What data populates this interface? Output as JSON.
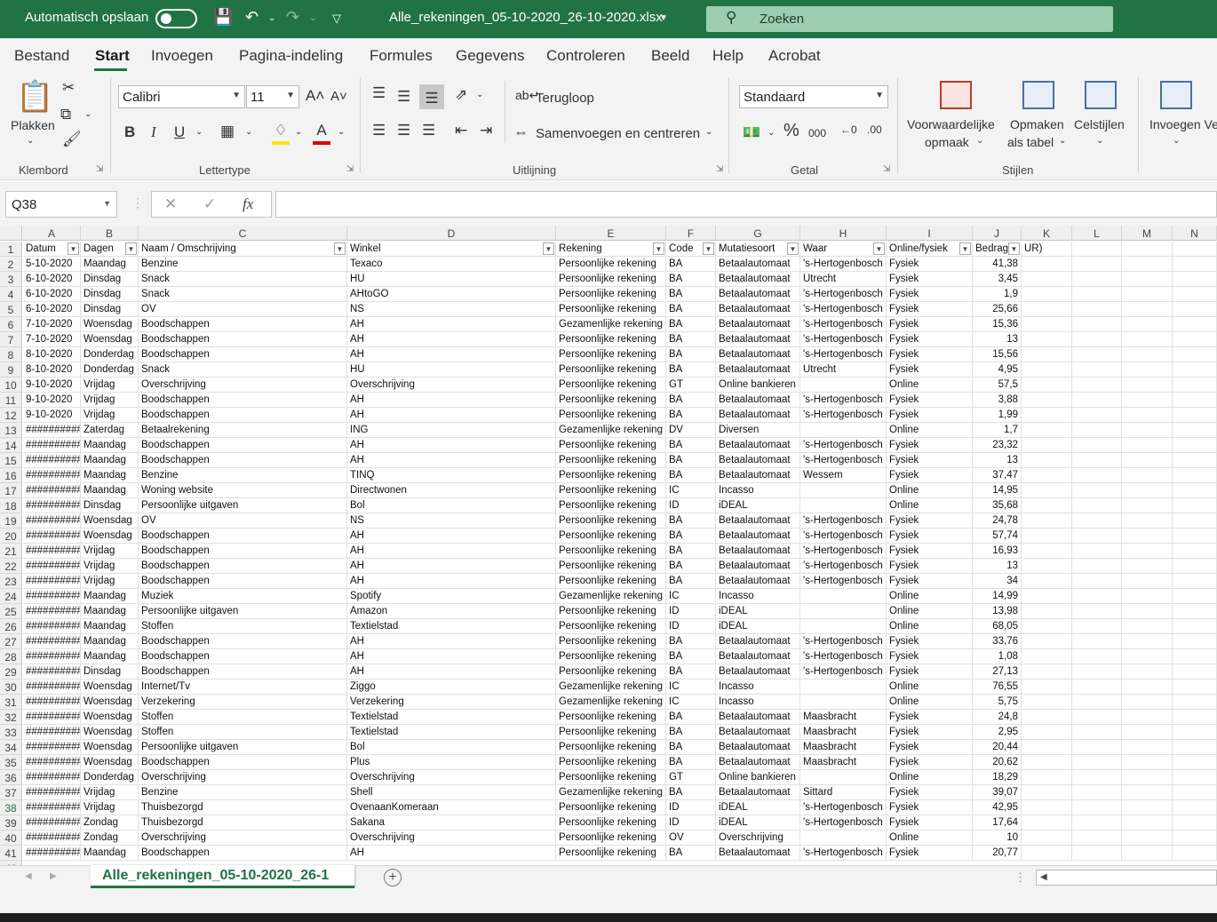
{
  "titlebar": {
    "autosave_label": "Automatisch opslaan",
    "filename": "Alle_rekeningen_05-10-2020_26-10-2020.xlsx",
    "search_placeholder": "Zoeken"
  },
  "menu": {
    "tabs": [
      "Bestand",
      "Start",
      "Invoegen",
      "Pagina-indeling",
      "Formules",
      "Gegevens",
      "Controleren",
      "Beeld",
      "Help",
      "Acrobat"
    ],
    "active": "Start"
  },
  "ribbon": {
    "clipboard": {
      "paste": "Plakken",
      "label": "Klembord"
    },
    "font": {
      "name": "Calibri",
      "size": "11",
      "label": "Lettertype"
    },
    "alignment": {
      "wrap": "Terugloop",
      "merge": "Samenvoegen en centreren",
      "label": "Uitlijning"
    },
    "number": {
      "format": "Standaard",
      "label": "Getal"
    },
    "styles": {
      "conditional_1": "Voorwaardelijke",
      "conditional_2": "opmaak",
      "table_1": "Opmaken",
      "table_2": "als tabel",
      "cellstyles": "Celstijlen",
      "label": "Stijlen"
    },
    "cells": {
      "insert": "Invoegen",
      "insert_tail": "Ve"
    }
  },
  "formula": {
    "namebox": "Q38",
    "fx": "fx",
    "content": ""
  },
  "columns": [
    "A",
    "B",
    "C",
    "D",
    "E",
    "F",
    "G",
    "H",
    "I",
    "J",
    "K",
    "L",
    "M",
    "N"
  ],
  "headers": [
    "Datum",
    "Dagen",
    "Naam / Omschrijving",
    "Winkel",
    "Rekening",
    "Code",
    "Mutatiesoort",
    "Waar",
    "Online/fysiek",
    "Bedrag",
    "UR)"
  ],
  "rows": [
    [
      "5-10-2020",
      "Maandag",
      "Benzine",
      "Texaco",
      "Persoonlijke rekening",
      "BA",
      "Betaalautomaat",
      "'s-Hertogenbosch",
      "Fysiek",
      "41,38"
    ],
    [
      "6-10-2020",
      "Dinsdag",
      "Snack",
      "HU",
      "Persoonlijke rekening",
      "BA",
      "Betaalautomaat",
      "Utrecht",
      "Fysiek",
      "3,45"
    ],
    [
      "6-10-2020",
      "Dinsdag",
      "Snack",
      "AHtoGO",
      "Persoonlijke rekening",
      "BA",
      "Betaalautomaat",
      "'s-Hertogenbosch",
      "Fysiek",
      "1,9"
    ],
    [
      "6-10-2020",
      "Dinsdag",
      "OV",
      "NS",
      "Persoonlijke rekening",
      "BA",
      "Betaalautomaat",
      "'s-Hertogenbosch",
      "Fysiek",
      "25,66"
    ],
    [
      "7-10-2020",
      "Woensdag",
      "Boodschappen",
      "AH",
      "Gezamenlijke rekening",
      "BA",
      "Betaalautomaat",
      "'s-Hertogenbosch",
      "Fysiek",
      "15,36"
    ],
    [
      "7-10-2020",
      "Woensdag",
      "Boodschappen",
      "AH",
      "Persoonlijke rekening",
      "BA",
      "Betaalautomaat",
      "'s-Hertogenbosch",
      "Fysiek",
      "13"
    ],
    [
      "8-10-2020",
      "Donderdag",
      "Boodschappen",
      "AH",
      "Persoonlijke rekening",
      "BA",
      "Betaalautomaat",
      "'s-Hertogenbosch",
      "Fysiek",
      "15,56"
    ],
    [
      "8-10-2020",
      "Donderdag",
      "Snack",
      "HU",
      "Persoonlijke rekening",
      "BA",
      "Betaalautomaat",
      "Utrecht",
      "Fysiek",
      "4,95"
    ],
    [
      "9-10-2020",
      "Vrijdag",
      "Overschrijving",
      "Overschrijving",
      "Persoonlijke rekening",
      "GT",
      "Online bankieren",
      "",
      "Online",
      "57,5"
    ],
    [
      "9-10-2020",
      "Vrijdag",
      "Boodschappen",
      "AH",
      "Persoonlijke rekening",
      "BA",
      "Betaalautomaat",
      "'s-Hertogenbosch",
      "Fysiek",
      "3,88"
    ],
    [
      "9-10-2020",
      "Vrijdag",
      "Boodschappen",
      "AH",
      "Persoonlijke rekening",
      "BA",
      "Betaalautomaat",
      "'s-Hertogenbosch",
      "Fysiek",
      "1,99"
    ],
    [
      "###########",
      "Zaterdag",
      "Betaalrekening",
      "ING",
      "Gezamenlijke rekening",
      "DV",
      "Diversen",
      "",
      "Online",
      "1,7"
    ],
    [
      "###########",
      "Maandag",
      "Boodschappen",
      "AH",
      "Persoonlijke rekening",
      "BA",
      "Betaalautomaat",
      "'s-Hertogenbosch",
      "Fysiek",
      "23,32"
    ],
    [
      "###########",
      "Maandag",
      "Boodschappen",
      "AH",
      "Persoonlijke rekening",
      "BA",
      "Betaalautomaat",
      "'s-Hertogenbosch",
      "Fysiek",
      "13"
    ],
    [
      "###########",
      "Maandag",
      "Benzine",
      "TINQ",
      "Persoonlijke rekening",
      "BA",
      "Betaalautomaat",
      "Wessem",
      "Fysiek",
      "37,47"
    ],
    [
      "###########",
      "Maandag",
      "Woning website",
      "Directwonen",
      "Persoonlijke rekening",
      "IC",
      "Incasso",
      "",
      "Online",
      "14,95"
    ],
    [
      "###########",
      "Dinsdag",
      "Persoonlijke uitgaven",
      "Bol",
      "Persoonlijke rekening",
      "ID",
      "iDEAL",
      "",
      "Online",
      "35,68"
    ],
    [
      "###########",
      "Woensdag",
      "OV",
      "NS",
      "Persoonlijke rekening",
      "BA",
      "Betaalautomaat",
      "'s-Hertogenbosch",
      "Fysiek",
      "24,78"
    ],
    [
      "###########",
      "Woensdag",
      "Boodschappen",
      "AH",
      "Persoonlijke rekening",
      "BA",
      "Betaalautomaat",
      "'s-Hertogenbosch",
      "Fysiek",
      "57,74"
    ],
    [
      "###########",
      "Vrijdag",
      "Boodschappen",
      "AH",
      "Persoonlijke rekening",
      "BA",
      "Betaalautomaat",
      "'s-Hertogenbosch",
      "Fysiek",
      "16,93"
    ],
    [
      "###########",
      "Vrijdag",
      "Boodschappen",
      "AH",
      "Persoonlijke rekening",
      "BA",
      "Betaalautomaat",
      "'s-Hertogenbosch",
      "Fysiek",
      "13"
    ],
    [
      "###########",
      "Vrijdag",
      "Boodschappen",
      "AH",
      "Persoonlijke rekening",
      "BA",
      "Betaalautomaat",
      "'s-Hertogenbosch",
      "Fysiek",
      "34"
    ],
    [
      "###########",
      "Maandag",
      "Muziek",
      "Spotify",
      "Gezamenlijke rekening",
      "IC",
      "Incasso",
      "",
      "Online",
      "14,99"
    ],
    [
      "###########",
      "Maandag",
      "Persoonlijke uitgaven",
      "Amazon",
      "Persoonlijke rekening",
      "ID",
      "iDEAL",
      "",
      "Online",
      "13,98"
    ],
    [
      "###########",
      "Maandag",
      "Stoffen",
      "Textielstad",
      "Persoonlijke rekening",
      "ID",
      "iDEAL",
      "",
      "Online",
      "68,05"
    ],
    [
      "###########",
      "Maandag",
      "Boodschappen",
      "AH",
      "Persoonlijke rekening",
      "BA",
      "Betaalautomaat",
      "'s-Hertogenbosch",
      "Fysiek",
      "33,76"
    ],
    [
      "###########",
      "Maandag",
      "Boodschappen",
      "AH",
      "Persoonlijke rekening",
      "BA",
      "Betaalautomaat",
      "'s-Hertogenbosch",
      "Fysiek",
      "1,08"
    ],
    [
      "###########",
      "Dinsdag",
      "Boodschappen",
      "AH",
      "Persoonlijke rekening",
      "BA",
      "Betaalautomaat",
      "'s-Hertogenbosch",
      "Fysiek",
      "27,13"
    ],
    [
      "###########",
      "Woensdag",
      "Internet/Tv",
      "Ziggo",
      "Gezamenlijke rekening",
      "IC",
      "Incasso",
      "",
      "Online",
      "76,55"
    ],
    [
      "###########",
      "Woensdag",
      "Verzekering",
      "Verzekering",
      "Gezamenlijke rekening",
      "IC",
      "Incasso",
      "",
      "Online",
      "5,75"
    ],
    [
      "###########",
      "Woensdag",
      "Stoffen",
      "Textielstad",
      "Persoonlijke rekening",
      "BA",
      "Betaalautomaat",
      "Maasbracht",
      "Fysiek",
      "24,8"
    ],
    [
      "###########",
      "Woensdag",
      "Stoffen",
      "Textielstad",
      "Persoonlijke rekening",
      "BA",
      "Betaalautomaat",
      "Maasbracht",
      "Fysiek",
      "2,95"
    ],
    [
      "###########",
      "Woensdag",
      "Persoonlijke uitgaven",
      "Bol",
      "Persoonlijke rekening",
      "BA",
      "Betaalautomaat",
      "Maasbracht",
      "Fysiek",
      "20,44"
    ],
    [
      "###########",
      "Woensdag",
      "Boodschappen",
      "Plus",
      "Persoonlijke rekening",
      "BA",
      "Betaalautomaat",
      "Maasbracht",
      "Fysiek",
      "20,62"
    ],
    [
      "###########",
      "Donderdag",
      "Overschrijving",
      "Overschrijving",
      "Persoonlijke rekening",
      "GT",
      "Online bankieren",
      "",
      "Online",
      "18,29"
    ],
    [
      "###########",
      "Vrijdag",
      "Benzine",
      "Shell",
      "Gezamenlijke rekening",
      "BA",
      "Betaalautomaat",
      "Sittard",
      "Fysiek",
      "39,07"
    ],
    [
      "###########",
      "Vrijdag",
      "Thuisbezorgd",
      "OvenaanKomeraan",
      "Persoonlijke rekening",
      "ID",
      "iDEAL",
      "'s-Hertogenbosch",
      "Fysiek",
      "42,95"
    ],
    [
      "###########",
      "Zondag",
      "Thuisbezorgd",
      "Sakana",
      "Persoonlijke rekening",
      "ID",
      "iDEAL",
      "'s-Hertogenbosch",
      "Fysiek",
      "17,64"
    ],
    [
      "###########",
      "Zondag",
      "Overschrijving",
      "Overschrijving",
      "Persoonlijke rekening",
      "OV",
      "Overschrijving",
      "",
      "Online",
      "10"
    ],
    [
      "###########",
      "Maandag",
      "Boodschappen",
      "AH",
      "Persoonlijke rekening",
      "BA",
      "Betaalautomaat",
      "'s-Hertogenbosch",
      "Fysiek",
      "20,77"
    ]
  ],
  "selected_row": 38,
  "sheet": {
    "tab_name": "Alle_rekeningen_05-10-2020_26-1"
  },
  "colors": {
    "excel_green": "#217346",
    "search_bg": "#9ccdb0"
  },
  "icons": [
    "toggle-icon",
    "save-icon",
    "undo-icon",
    "redo-icon",
    "customize-icon",
    "search-icon"
  ]
}
